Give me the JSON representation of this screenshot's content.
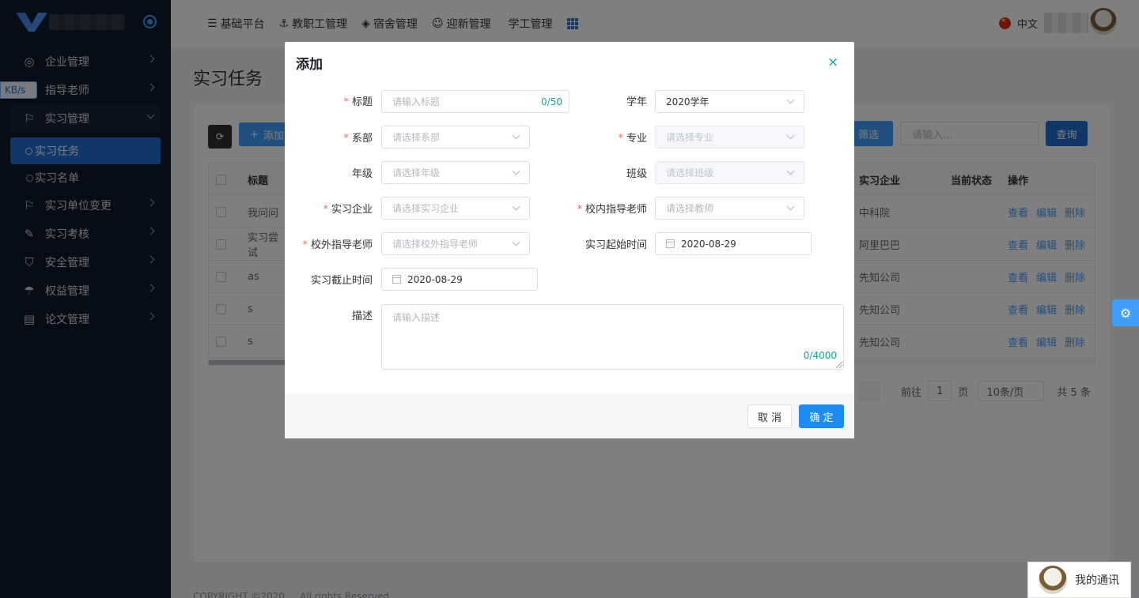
{
  "sidebar": {
    "speed_badge": "KB/s",
    "menu": [
      {
        "label": "企业管理",
        "icon": "globe-icon"
      },
      {
        "label": "指导老师",
        "icon": "user-icon"
      },
      {
        "label": "实习管理",
        "icon": "flag-icon"
      },
      {
        "label": "实习单位变更",
        "icon": "flag-icon"
      },
      {
        "label": "实习考核",
        "icon": "pen-icon"
      },
      {
        "label": "安全管理",
        "icon": "shield-icon"
      },
      {
        "label": "权益管理",
        "icon": "umbrella-icon"
      },
      {
        "label": "论文管理",
        "icon": "document-icon"
      }
    ],
    "submenu": [
      "实习任务",
      "实习名单"
    ]
  },
  "topnav": {
    "items": [
      "基础平台",
      "教职工管理",
      "宿舍管理",
      "迎新管理",
      "学工管理"
    ],
    "language": "中文"
  },
  "page": {
    "title": "实习任务",
    "add_label": "添加",
    "filter_label": "筛选",
    "search_placeholder": "请输入...",
    "query_label": "查询",
    "columns": {
      "title": "标题",
      "enterprise": "实习企业",
      "state": "当前状态",
      "ops": "操作"
    },
    "rows": [
      {
        "title": "我问问",
        "enterprise": "中科院"
      },
      {
        "title": "实习尝试",
        "enterprise": "阿里巴巴"
      },
      {
        "title": "as",
        "enterprise": "先知公司"
      },
      {
        "title": "s",
        "enterprise": "先知公司"
      },
      {
        "title": "s",
        "enterprise": "先知公司"
      }
    ],
    "ops": {
      "view": "查看",
      "edit": "编辑",
      "delete": "删除"
    },
    "pager": {
      "goto": "前往",
      "page": "1",
      "page_unit": "页",
      "size": "10条/页",
      "total": "共 5 条"
    },
    "footer": "COPYRIGHT ©2020 ... All rights Reserved"
  },
  "chat": {
    "label": "我的通讯"
  },
  "dialog": {
    "title": "添加",
    "close": "×",
    "fields": {
      "title_label": "标题",
      "title_placeholder": "请输入标题",
      "title_count": "0/50",
      "year_label": "学年",
      "year_value": "2020学年",
      "dept_label": "系部",
      "dept_placeholder": "请选择系部",
      "major_label": "专业",
      "major_placeholder": "请选择专业",
      "grade_label": "年级",
      "grade_placeholder": "请选择年级",
      "class_label": "班级",
      "class_placeholder": "请选择班级",
      "ent_label": "实习企业",
      "ent_placeholder": "请选择实习企业",
      "inner_label": "校内指导老师",
      "inner_placeholder": "请选择教师",
      "outer_label": "校外指导老师",
      "outer_placeholder": "请选择校外指导老师",
      "start_label": "实习起始时间",
      "start_value": "2020-08-29",
      "end_label": "实习截止时间",
      "end_value": "2020-08-29",
      "desc_label": "描述",
      "desc_placeholder": "请输入描述",
      "desc_count": "0/4000"
    },
    "cancel_label": "取 消",
    "ok_label": "确 定"
  }
}
